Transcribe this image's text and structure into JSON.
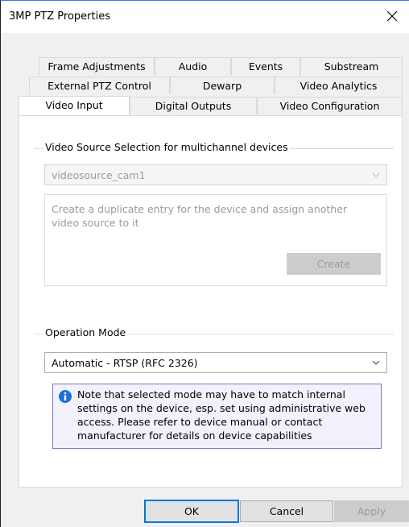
{
  "window": {
    "title": "3MP PTZ Properties"
  },
  "tabs": {
    "row1": [
      "Frame Adjustments",
      "Audio",
      "Events",
      "Substream"
    ],
    "row2": [
      "External PTZ Control",
      "Dewarp",
      "Video Analytics"
    ],
    "row3": [
      "Video Input",
      "Digital Outputs",
      "Video Configuration"
    ],
    "active": "Video Input"
  },
  "video_source": {
    "group_label": "Video Source Selection for multichannel devices",
    "selected": "videosource_cam1",
    "help_text": "Create a duplicate entry for the device and assign another video source to it",
    "create_label": "Create"
  },
  "operation_mode": {
    "group_label": "Operation Mode",
    "selected": "Automatic - RTSP (RFC 2326)",
    "note": "Note that selected mode may have to match internal settings on the device, esp. set using administrative web access. Please refer to device manual or contact manufacturer for details on device capabilities"
  },
  "footer": {
    "ok": "OK",
    "cancel": "Cancel",
    "apply": "Apply"
  },
  "colors": {
    "info_accent": "#1e6fd9",
    "info_bg": "#f2f1fc",
    "info_border": "#7d79c9",
    "default_button_border": "#0078d7"
  },
  "icons": {
    "close": "close-icon",
    "info": "info-icon",
    "dropdown": "chevron-down-icon"
  }
}
